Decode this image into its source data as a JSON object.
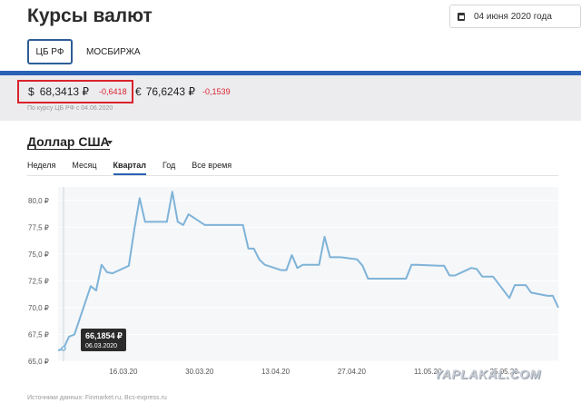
{
  "page": {
    "title": "Курсы валют",
    "date_picker": {
      "value": "04 июня 2020 года",
      "icon": "calendar-icon"
    }
  },
  "source_tabs": [
    {
      "label": "ЦБ РФ",
      "active": true
    },
    {
      "label": "МОСБИРЖА",
      "active": false
    }
  ],
  "rates": {
    "usd": {
      "symbol": "$",
      "value": "68,3413 ₽",
      "change": "-0,6418"
    },
    "eur": {
      "symbol": "€",
      "value": "76,6243 ₽",
      "change": "-0,1539"
    },
    "note": "По курсу ЦБ РФ с 04.06.2020",
    "colors": {
      "highlight_box": "#d9232d",
      "negative_change": "#d9232d",
      "accent_bar": "#2a62b6"
    }
  },
  "currency_selector": {
    "label": "Доллар США"
  },
  "period_tabs": [
    {
      "label": "Неделя",
      "active": false
    },
    {
      "label": "Месяц",
      "active": false
    },
    {
      "label": "Квартал",
      "active": true
    },
    {
      "label": "Год",
      "active": false
    },
    {
      "label": "Все время",
      "active": false
    }
  ],
  "chart_data": {
    "type": "line",
    "title": "",
    "xlabel": "",
    "ylabel": "",
    "ylim": [
      65.0,
      81.25
    ],
    "xlim": [
      "2020-03-04",
      "2020-06-04"
    ],
    "y_ticks": [
      "65,0 ₽",
      "67,5 ₽",
      "70,0 ₽",
      "72,5 ₽",
      "75,0 ₽",
      "77,5 ₽",
      "80,0 ₽"
    ],
    "y_tick_values": [
      65.0,
      67.5,
      70.0,
      72.5,
      75.0,
      77.5,
      80.0
    ],
    "x_ticks": [
      "16.03.20",
      "30.03.20",
      "13.04.20",
      "27.04.20",
      "11.05.20",
      "25.05.20"
    ],
    "x_tick_dates": [
      "2020-03-16",
      "2020-03-30",
      "2020-04-13",
      "2020-04-27",
      "2020-05-11",
      "2020-05-25"
    ],
    "line_color": "#7fb3d8",
    "tooltip": {
      "value": "66,1854 ₽",
      "date": "06.03.2020",
      "point_index": 1
    },
    "series": [
      {
        "x": [
          "2020-03-04",
          "2020-03-05",
          "2020-03-06",
          "2020-03-07",
          "2020-03-10",
          "2020-03-11",
          "2020-03-12",
          "2020-03-13",
          "2020-03-14",
          "2020-03-17",
          "2020-03-18",
          "2020-03-19",
          "2020-03-20",
          "2020-03-21",
          "2020-03-24",
          "2020-03-25",
          "2020-03-26",
          "2020-03-27",
          "2020-03-28",
          "2020-03-31",
          "2020-04-01",
          "2020-04-02",
          "2020-04-03",
          "2020-04-04",
          "2020-04-07",
          "2020-04-08",
          "2020-04-09",
          "2020-04-10",
          "2020-04-11",
          "2020-04-14",
          "2020-04-15",
          "2020-04-16",
          "2020-04-17",
          "2020-04-18",
          "2020-04-21",
          "2020-04-22",
          "2020-04-23",
          "2020-04-24",
          "2020-04-25",
          "2020-04-28",
          "2020-04-29",
          "2020-04-30",
          "2020-05-01",
          "2020-05-06",
          "2020-05-07",
          "2020-05-08",
          "2020-05-09",
          "2020-05-13",
          "2020-05-14",
          "2020-05-15",
          "2020-05-16",
          "2020-05-19",
          "2020-05-20",
          "2020-05-21",
          "2020-05-22",
          "2020-05-23",
          "2020-05-26",
          "2020-05-27",
          "2020-05-28",
          "2020-05-29",
          "2020-05-30",
          "2020-06-02",
          "2020-06-03",
          "2020-06-04"
        ],
        "values": [
          66.0,
          66.19,
          67.29,
          67.5,
          72.0,
          71.6,
          74.0,
          73.3,
          73.2,
          73.9,
          77.2,
          80.2,
          78.0,
          78.0,
          78.0,
          80.8,
          78.0,
          77.7,
          78.7,
          77.7,
          77.7,
          77.7,
          77.7,
          77.7,
          77.7,
          75.5,
          75.5,
          74.5,
          74.0,
          73.5,
          73.5,
          74.9,
          73.7,
          74.0,
          74.0,
          76.6,
          74.7,
          74.7,
          74.7,
          74.5,
          73.9,
          72.7,
          72.7,
          72.7,
          72.7,
          74.0,
          74.0,
          73.9,
          73.9,
          73.0,
          73.0,
          73.7,
          73.6,
          72.9,
          72.9,
          72.9,
          70.9,
          72.1,
          72.1,
          72.1,
          71.4,
          71.1,
          71.1,
          70.0
        ]
      }
    ]
  },
  "footer": {
    "note": "Источники данных: Finmarket.ru, Bcs-express.ru"
  },
  "watermark": {
    "text": "YAPLAKAL.COM"
  }
}
